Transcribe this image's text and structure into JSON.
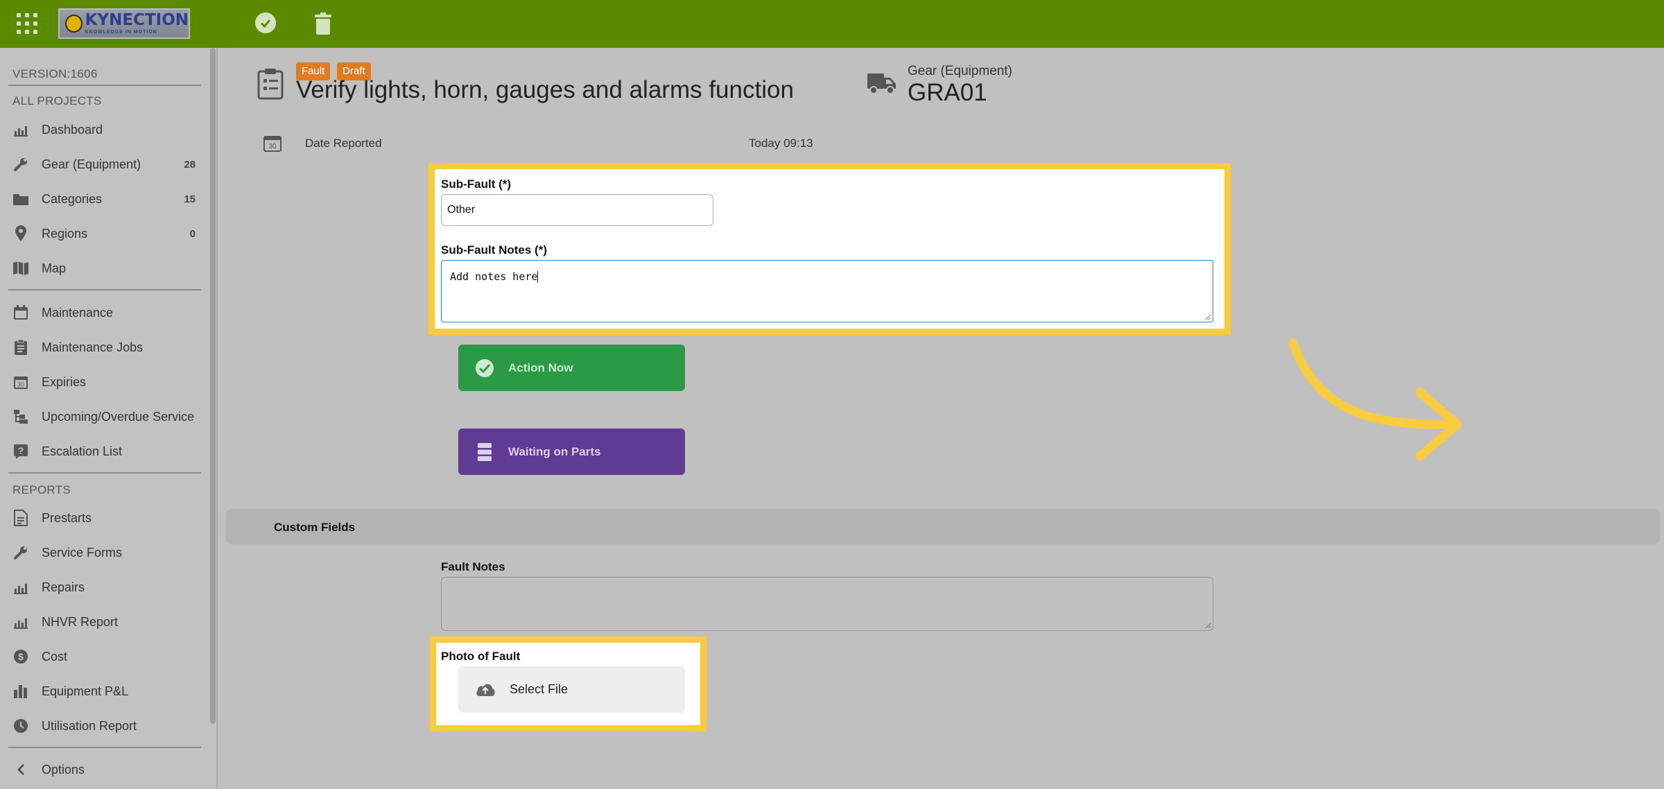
{
  "app": {
    "logo_text": "KYNECTION",
    "logo_tagline": "KNOWLEDGE IN MOTION"
  },
  "sidebar": {
    "version": "VERSION:1606",
    "section_projects": "ALL PROJECTS",
    "section_reports": "REPORTS",
    "items": [
      {
        "label": "Dashboard",
        "icon": "chart-icon",
        "count": ""
      },
      {
        "label": "Gear (Equipment)",
        "icon": "wrench-icon",
        "count": "28"
      },
      {
        "label": "Categories",
        "icon": "folder-icon",
        "count": "15"
      },
      {
        "label": "Regions",
        "icon": "pin-icon",
        "count": "0"
      },
      {
        "label": "Map",
        "icon": "map-icon",
        "count": ""
      },
      {
        "label": "Maintenance",
        "icon": "calendar-icon",
        "count": ""
      },
      {
        "label": "Maintenance Jobs",
        "icon": "clipboard-icon",
        "count": ""
      },
      {
        "label": "Expiries",
        "icon": "calendar-30-icon",
        "count": ""
      },
      {
        "label": "Upcoming/Overdue Service",
        "icon": "tree-icon",
        "count": ""
      },
      {
        "label": "Escalation List",
        "icon": "question-icon",
        "count": ""
      },
      {
        "label": "Prestarts",
        "icon": "document-icon",
        "count": ""
      },
      {
        "label": "Service Forms",
        "icon": "wrench-icon",
        "count": ""
      },
      {
        "label": "Repairs",
        "icon": "chart-icon",
        "count": ""
      },
      {
        "label": "NHVR Report",
        "icon": "chart-icon",
        "count": ""
      },
      {
        "label": "Cost",
        "icon": "dollar-icon",
        "count": ""
      },
      {
        "label": "Equipment P&L",
        "icon": "bars-icon",
        "count": ""
      },
      {
        "label": "Utilisation Report",
        "icon": "clock-icon",
        "count": ""
      }
    ],
    "options": "Options"
  },
  "header": {
    "tags": [
      "Fault",
      "Draft"
    ],
    "title": "Verify lights, horn, gauges and alarms function",
    "gear_label": "Gear (Equipment)",
    "gear_value": "GRA01"
  },
  "date": {
    "label": "Date Reported",
    "value": "Today 09:13"
  },
  "form": {
    "subfault_label": "Sub-Fault (*)",
    "subfault_value": "Other",
    "subfault_notes_label": "Sub-Fault Notes (*)",
    "subfault_notes_value": "Add notes here",
    "action_now": "Action Now",
    "waiting_parts": "Waiting on Parts",
    "custom_fields": "Custom Fields",
    "fault_notes_label": "Fault Notes",
    "photo_label": "Photo of Fault",
    "select_file": "Select File"
  },
  "colors": {
    "topbar": "#5a8a00",
    "highlight": "#f7cc3f",
    "action_green": "#2a9a45",
    "waiting_purple": "#5f3b94",
    "tag_orange": "#e07b22"
  }
}
